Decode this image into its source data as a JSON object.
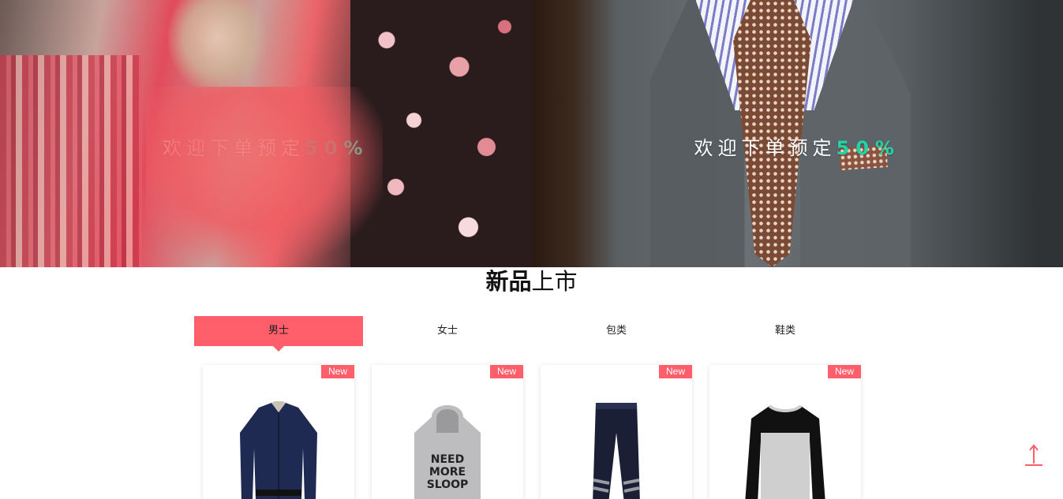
{
  "banner": {
    "left": {
      "caption_text": "欢迎下单预定",
      "caption_accent": "50%"
    },
    "right": {
      "caption_text": "欢迎下单预定",
      "caption_accent": "50%"
    },
    "accent_color": "#22d3a6"
  },
  "section": {
    "title_bold": "新品",
    "title_light": "上市"
  },
  "tabs": [
    {
      "label": "男士",
      "active": true
    },
    {
      "label": "女士",
      "active": false
    },
    {
      "label": "包类",
      "active": false
    },
    {
      "label": "鞋类",
      "active": false
    }
  ],
  "products": [
    {
      "badge": "New",
      "icon": "dress-shirt-icon"
    },
    {
      "badge": "New",
      "icon": "hoodie-icon",
      "print_text": [
        "NEED",
        "MORE",
        "SLOOP"
      ]
    },
    {
      "badge": "New",
      "icon": "pants-icon"
    },
    {
      "badge": "New",
      "icon": "long-sleeve-tee-icon"
    }
  ],
  "back_to_top": {
    "icon": "arrow-up-icon"
  },
  "colors": {
    "brand": "#ff5e6a"
  }
}
